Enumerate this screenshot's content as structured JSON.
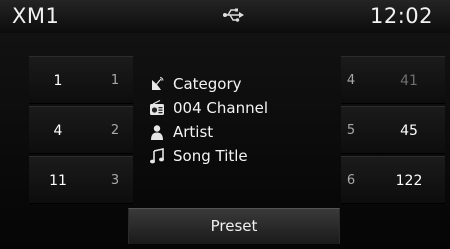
{
  "status_bar": {
    "source": "XM1",
    "usb_icon": "usb-icon",
    "time": "12:02"
  },
  "presets_left": [
    {
      "value": "1",
      "slot": "1"
    },
    {
      "value": "4",
      "slot": "2"
    },
    {
      "value": "11",
      "slot": "3"
    }
  ],
  "presets_right": [
    {
      "slot": "4",
      "value": "41",
      "dimmed": true
    },
    {
      "slot": "5",
      "value": "45",
      "dimmed": false
    },
    {
      "slot": "6",
      "value": "122",
      "dimmed": false
    }
  ],
  "info": {
    "category": {
      "icon": "antenna-icon",
      "text": "Category"
    },
    "channel": {
      "icon": "radio-icon",
      "text": "004 Channel"
    },
    "artist": {
      "icon": "person-icon",
      "text": "Artist"
    },
    "song": {
      "icon": "music-note-icon",
      "text": "Song Title"
    }
  },
  "preset_button_label": "Preset"
}
